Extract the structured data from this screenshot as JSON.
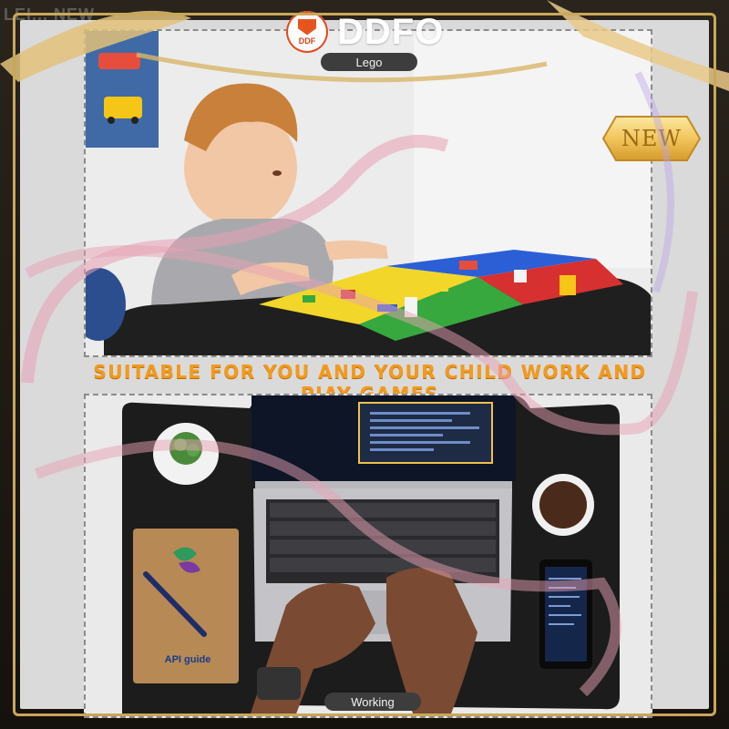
{
  "brand": {
    "badge_abbr": "DDF",
    "name": "DDFO"
  },
  "watermark_corner": "LEI... NEW",
  "top_panel": {
    "label": "Lego"
  },
  "caption": "SUITABLE FOR YOU AND YOUR CHILD WORK AND PIAY GAMES",
  "new_badge": "NEW",
  "bottom_panel": {
    "label": "Working",
    "notebook_text": "API guide"
  },
  "colors": {
    "caption_orange": "#f39a1c",
    "gold_frame": "#c9a75a",
    "pink_ribbon": "#e8a1b4",
    "logo_red": "#e24a1f",
    "lego_red": "#d63030",
    "lego_blue": "#2c5fd6",
    "lego_yellow": "#f2d62a",
    "lego_green": "#36a83e",
    "desk_black": "#1e1e1e"
  }
}
